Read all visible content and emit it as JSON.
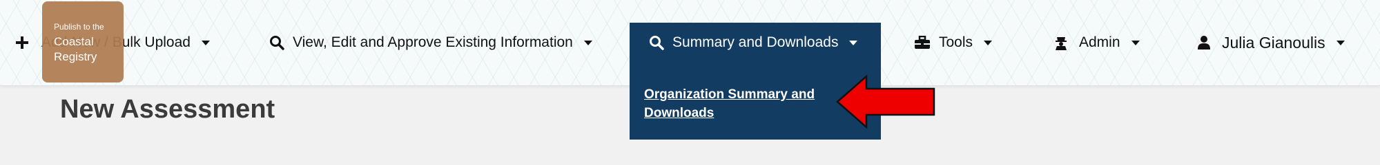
{
  "nav": {
    "add": {
      "label": "Add New / Bulk Upload",
      "icon": "plus-icon"
    },
    "view": {
      "label": "View, Edit and Approve Existing Information",
      "icon": "search-icon"
    },
    "summary": {
      "label": "Summary and Downloads",
      "icon": "search-icon"
    },
    "tools": {
      "label": "Tools",
      "icon": "toolbox-icon"
    },
    "admin": {
      "label": "Admin",
      "icon": "admin-icon"
    },
    "user": {
      "label": "Julia Gianoulis",
      "icon": "user-icon"
    }
  },
  "logo": {
    "line1": "Publish to the",
    "line2": "Coastal",
    "line3": "Registry"
  },
  "dropdown": {
    "item": "Organization Summary and Downloads"
  },
  "page": {
    "title": "New Assessment"
  },
  "colors": {
    "nav_active_bg": "#133c62",
    "annotation_arrow": "#ee0000"
  }
}
